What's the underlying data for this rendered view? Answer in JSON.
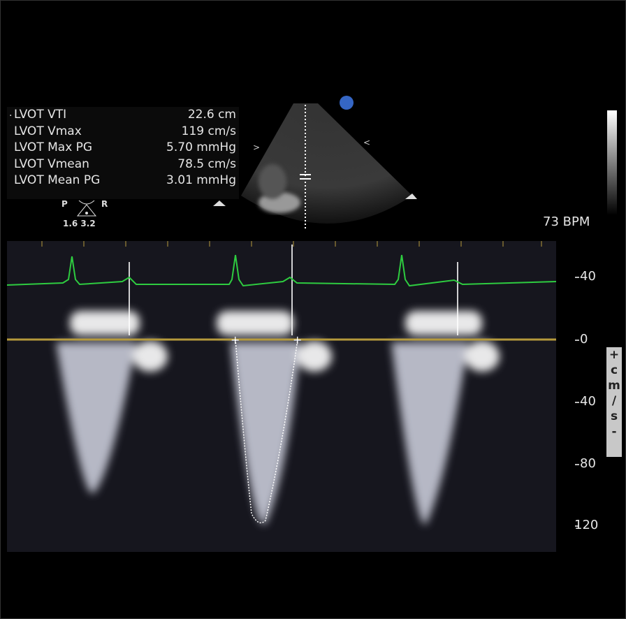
{
  "measurements": [
    {
      "label": "LVOT VTI",
      "value": "22.6 cm"
    },
    {
      "label": "LVOT Vmax",
      "value": "119 cm/s"
    },
    {
      "label": "LVOT Max PG",
      "value": "5.70 mmHg"
    },
    {
      "label": "LVOT Vmean",
      "value": "78.5 cm/s"
    },
    {
      "label": "LVOT Mean PG",
      "value": "3.01 mmHg"
    }
  ],
  "probe": {
    "left": "P",
    "right": "R",
    "values": "1.6 3.2"
  },
  "heart_rate": "73 BPM",
  "velocity_scale": {
    "ticks": [
      "40",
      "0",
      "40",
      "80",
      "120"
    ],
    "unit": [
      "+",
      "c",
      "m",
      "/",
      "s",
      "-"
    ]
  },
  "colors": {
    "ecg": "#2ecc40",
    "baseline": "#b59a3c",
    "trace": "#ffffff"
  }
}
